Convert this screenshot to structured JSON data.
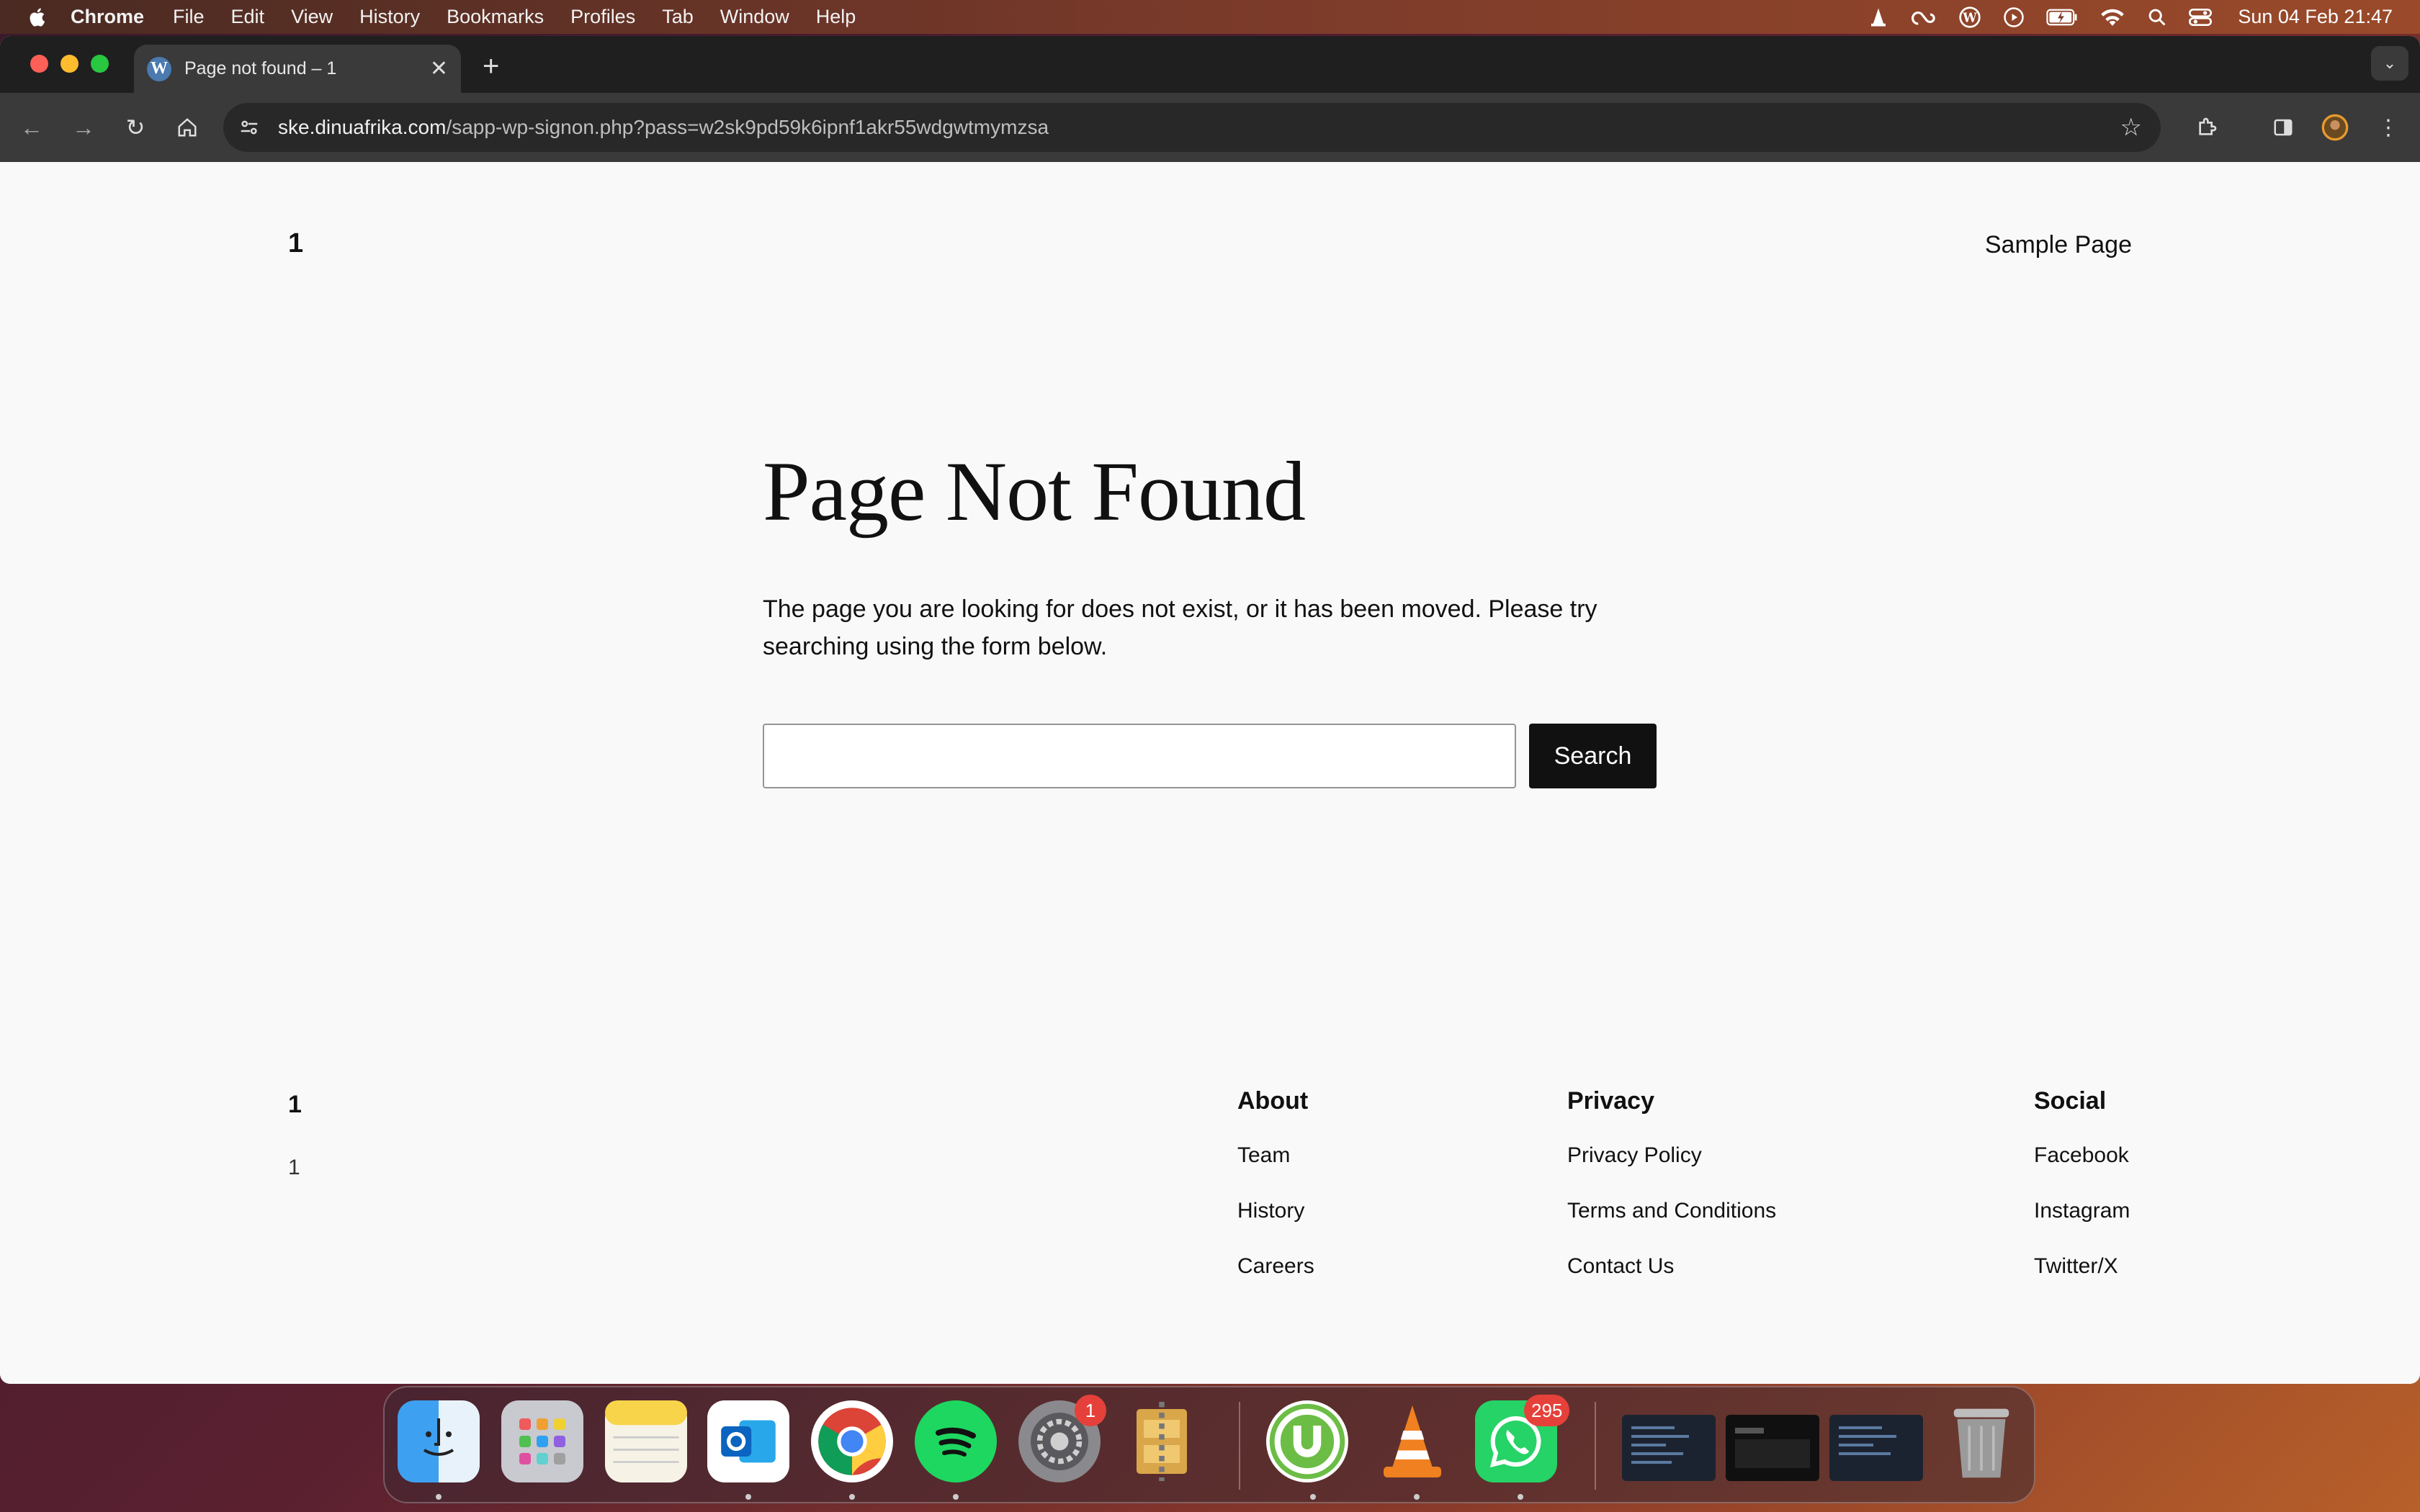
{
  "menubar": {
    "app": "Chrome",
    "items": [
      "File",
      "Edit",
      "View",
      "History",
      "Bookmarks",
      "Profiles",
      "Tab",
      "Window",
      "Help"
    ],
    "clock": "Sun 04 Feb  21:47"
  },
  "browser": {
    "tab_title": "Page not found – 1",
    "url_host": "ske.dinuafrika.com",
    "url_path": "/sapp-wp-signon.php?pass=w2sk9pd59k6ipnf1akr55wdgwtmymzsa"
  },
  "site": {
    "title": "1",
    "nav_item": "Sample Page"
  },
  "content": {
    "heading": "Page Not Found",
    "description": "The page you are looking for does not exist, or it has been moved. Please try searching using the form below.",
    "search_placeholder": "",
    "search_button": "Search"
  },
  "footer": {
    "title": "1",
    "tagline": "1",
    "columns": [
      {
        "heading": "About",
        "links": [
          "Team",
          "History",
          "Careers"
        ]
      },
      {
        "heading": "Privacy",
        "links": [
          "Privacy Policy",
          "Terms and Conditions",
          "Contact Us"
        ]
      },
      {
        "heading": "Social",
        "links": [
          "Facebook",
          "Instagram",
          "Twitter/X"
        ]
      }
    ]
  },
  "dock": {
    "badges": {
      "system_settings": "1",
      "whatsapp": "295"
    }
  }
}
